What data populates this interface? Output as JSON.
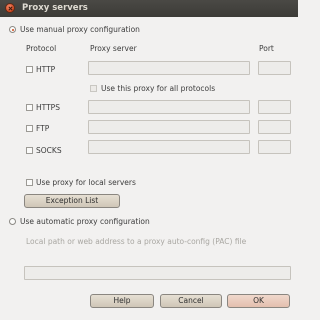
{
  "window": {
    "title": "Proxy servers"
  },
  "mode": {
    "manual_label": "Use manual proxy configuration",
    "auto_label": "Use automatic proxy configuration",
    "selected": "manual"
  },
  "columns": {
    "protocol": "Protocol",
    "server": "Proxy server",
    "port": "Port"
  },
  "proxies": [
    {
      "label": "HTTP",
      "server": "",
      "port": ""
    },
    {
      "label": "HTTPS",
      "server": "",
      "port": ""
    },
    {
      "label": "FTP",
      "server": "",
      "port": ""
    },
    {
      "label": "SOCKS",
      "server": "",
      "port": ""
    }
  ],
  "use_for_all_label": "Use this proxy for all protocols",
  "local_servers_label": "Use proxy for local servers",
  "exception_button": "Exception List",
  "pac": {
    "hint": "Local path or web address to a proxy auto-config (PAC) file",
    "value": ""
  },
  "buttons": {
    "help": "Help",
    "cancel": "Cancel",
    "ok": "OK"
  }
}
